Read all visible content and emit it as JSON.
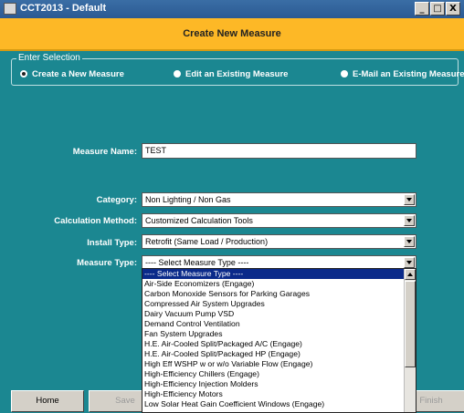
{
  "window": {
    "title": "CCT2013 - Default",
    "controls": {
      "minimize": "_",
      "maximize": "□",
      "close": "X"
    }
  },
  "header": {
    "title": "Create New Measure"
  },
  "selection": {
    "legend": "Enter Selection",
    "options": [
      {
        "label": "Create a New Measure",
        "selected": true
      },
      {
        "label": "Edit an Existing Measure",
        "selected": false
      },
      {
        "label": "E-Mail an Existing Measure",
        "selected": false
      }
    ]
  },
  "form": {
    "measure_name": {
      "label": "Measure Name:",
      "value": "TEST"
    },
    "category": {
      "label": "Category:",
      "value": "Non Lighting / Non Gas"
    },
    "calculation_method": {
      "label": "Calculation Method:",
      "value": "Customized Calculation Tools"
    },
    "install_type": {
      "label": "Install Type:",
      "value": "Retrofit (Same Load / Production)"
    },
    "measure_type": {
      "label": "Measure Type:",
      "value": "---- Select Measure Type ----",
      "options": [
        "---- Select Measure Type ----",
        "Air-Side Economizers (Engage)",
        "Carbon Monoxide Sensors for Parking Garages",
        "Compressed Air System Upgrades",
        "Dairy Vacuum Pump VSD",
        "Demand Control Ventilation",
        "Fan System Upgrades",
        "H.E. Air-Cooled Split/Packaged A/C (Engage)",
        "H.E. Air-Cooled Split/Packaged HP (Engage)",
        "High Eff WSHP w or w/o Variable Flow (Engage)",
        "High-Efficiency Chillers (Engage)",
        "High-Efficiency Injection Molders",
        "High-Efficiency Motors",
        "Low Solar Heat Gain Coefficient Windows (Engage)"
      ],
      "highlighted_index": 0
    }
  },
  "footer": {
    "home": "Home",
    "save": "Save",
    "finish": "Finish"
  }
}
